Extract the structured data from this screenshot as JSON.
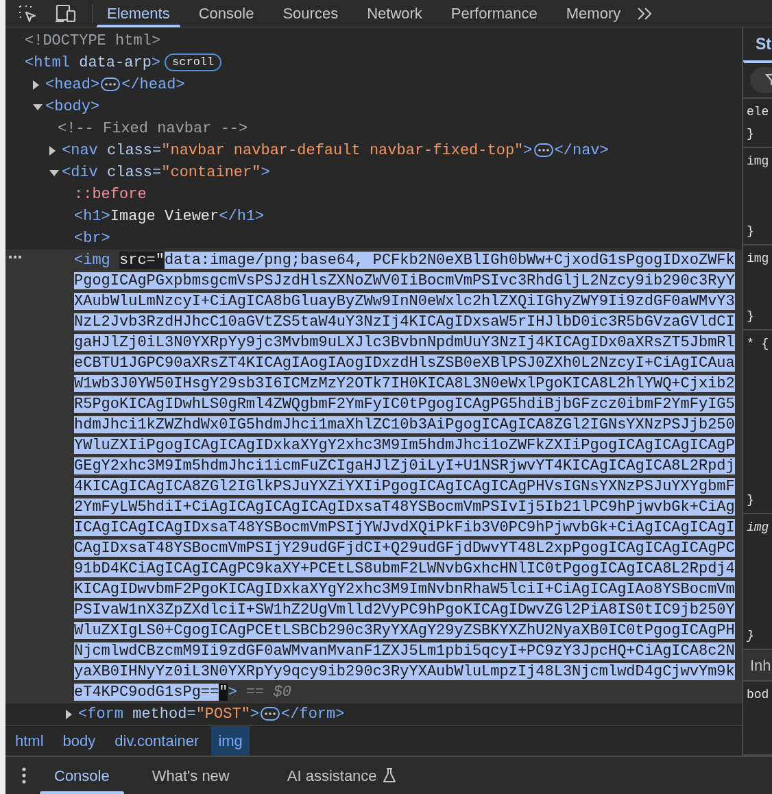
{
  "toolbar": {
    "tabs": [
      {
        "label": "Elements",
        "selected": true
      },
      {
        "label": "Console",
        "selected": false
      },
      {
        "label": "Sources",
        "selected": false
      },
      {
        "label": "Network",
        "selected": false
      },
      {
        "label": "Performance",
        "selected": false
      },
      {
        "label": "Memory",
        "selected": false
      }
    ]
  },
  "dom": [
    {
      "selected": false,
      "tokens": [
        {
          "kind": "doctype",
          "text": "<!DOCTYPE html>"
        }
      ]
    },
    {
      "selected": false,
      "tokens": [
        {
          "kind": "tag",
          "text": "<html"
        },
        {
          "kind": "attr",
          "text": " data-arp"
        },
        {
          "kind": "tag",
          "text": ">"
        },
        {
          "kind": "badge",
          "text": "scroll"
        }
      ],
      "children": [
        {
          "selected": false,
          "expanded": false,
          "tokens": [
            {
              "kind": "tag",
              "text": "<head>"
            },
            {
              "kind": "ellipsis"
            },
            {
              "kind": "tag",
              "text": "</head>"
            }
          ]
        },
        {
          "selected": false,
          "expanded": true,
          "tokens": [
            {
              "kind": "tag",
              "text": "<body>"
            }
          ],
          "children": [
            {
              "selected": false,
              "tokens": [
                {
                  "kind": "comment",
                  "text": "<!-- Fixed navbar -->"
                }
              ]
            },
            {
              "selected": false,
              "expanded": false,
              "tokens": [
                {
                  "kind": "tag",
                  "text": "<nav"
                },
                {
                  "kind": "attr",
                  "text": " class="
                },
                {
                  "kind": "value",
                  "text": "\"navbar navbar-default navbar-fixed-top\""
                },
                {
                  "kind": "tag",
                  "text": ">"
                },
                {
                  "kind": "ellipsis"
                },
                {
                  "kind": "tag",
                  "text": "</nav>"
                }
              ]
            },
            {
              "selected": false,
              "expanded": true,
              "tokens": [
                {
                  "kind": "tag",
                  "text": "<div"
                },
                {
                  "kind": "attr",
                  "text": " class="
                },
                {
                  "kind": "value",
                  "text": "\"container\""
                },
                {
                  "kind": "tag",
                  "text": ">"
                }
              ],
              "children": [
                {
                  "selected": false,
                  "tokens": [
                    {
                      "kind": "pseudo",
                      "text": "::before"
                    }
                  ]
                },
                {
                  "selected": false,
                  "tokens": [
                    {
                      "kind": "tag",
                      "text": "<h1>"
                    },
                    {
                      "kind": "text",
                      "text": "Image Viewer"
                    },
                    {
                      "kind": "tag",
                      "text": "</h1>"
                    }
                  ]
                },
                {
                  "selected": false,
                  "tokens": [
                    {
                      "kind": "tag",
                      "text": "<br>"
                    }
                  ]
                },
                {
                  "selected": true,
                  "tokens": [
                    {
                      "kind": "tag",
                      "text": "<img "
                    },
                    {
                      "kind": "boxed",
                      "text": "src=\""
                    },
                    {
                      "kind": "selection",
                      "lines": [
                        "data:image/png;base64, PCFkb2N0eXBlIGh0bWw+CjxodG1sPgogIDxoZWFk",
                        "PgogICAgPGxpbmsgcmVsPSJzdHlsZXNoZWV0IiBocmVmPSIvc3RhdGljL2Nzcy9ib290c3RyY",
                        "XAubWluLmNzcyI+CiAgICA8bGluayByZWw9InN0eWxlc2hlZXQiIGhyZWY9Ii9zdGF0aWMvY3",
                        "NzL2Jvb3RzdHJhcC10aGVtZS5taW4uY3NzIj4KICAgIDxsaW5rIHJlbD0ic3R5bGVzaGVldCI",
                        "gaHJlZj0iL3N0YXRpYy9jc3Mvbm9uLXJlc3BvbnNpdmUuY3NzIj4KICAgIDx0aXRsZT5JbmRl",
                        "eCBTU1JGPC90aXRsZT4KICAgIAogIAogIDxzdHlsZSB0eXBlPSJ0ZXh0L2NzcyI+CiAgICAua",
                        "W1wb3J0YW50IHsgY29sb3I6ICMzMzY2OTk7IH0KICA8L3N0eWxlPgoKICA8L2hlYWQ+Cjxib2",
                        "R5PgoKICAgIDwhLS0gRml4ZWQgbmF2YmFyIC0tPgogICAgPG5hdiBjbGFzcz0ibmF2YmFyIG5",
                        "hdmJhci1kZWZhdWx0IG5hdmJhci1maXhlZC10b3AiPgogICAgICA8ZGl2IGNsYXNzPSJjb250",
                        "YWluZXIiPgogICAgICAgIDxkaXYgY2xhc3M9Im5hdmJhci1oZWFkZXIiPgogICAgICAgICAgP",
                        "GEgY2xhc3M9Im5hdmJhci1icmFuZCIgaHJlZj0iLyI+U1NSRjwvYT4KICAgICAgICA8L2Rpdj",
                        "4KICAgICAgICA8ZGl2IGlkPSJuYXZiYXIiPgogICAgICAgICAgPHVsIGNsYXNzPSJuYXYgbmF",
                        "2YmFyLW5hdiI+CiAgICAgICAgICAgIDxsaT48YSBocmVmPSIvIj5Ib21lPC9hPjwvbGk+CiAg",
                        "ICAgICAgICAgIDxsaT48YSBocmVmPSIjYWJvdXQiPkFib3V0PC9hPjwvbGk+CiAgICAgICAgI",
                        "CAgIDxsaT48YSBocmVmPSIjY29udGFjdCI+Q29udGFjdDwvYT48L2xpPgogICAgICAgICAgPC",
                        "91bD4KCiAgICAgICAgPC9kaXY+PCEtLS8ubmF2LWNvbGxhcHNlIC0tPgogICAgICA8L2Rpdj4",
                        "KICAgIDwvbmF2PgoKICAgIDxkaXYgY2xhc3M9ImNvbnRhaW5lciI+CiAgICAgIAo8YSBocmVm",
                        "PSIvaW1nX3ZpZXdlciI+SW1hZ2UgVmlld2VyPC9hPgoKICAgIDwvZGl2PiA8IS0tIC9jb250Y",
                        "WluZXIgLS0+CgogICAgPCEtLSBCb290c3RyYXAgY29yZSBKYXZhU2NyaXB0IC0tPgogICAgPH",
                        "NjcmlwdCBzcmM9Ii9zdGF0aWMvanMvanF1ZXJ5Lm1pbi5qcyI+PC9zY3JpcHQ+CiAgICA8c2N",
                        "yaXB0IHNyYz0iL3N0YXRpYy9qcy9ib290c3RyYXAubWluLmpzIj48L3NjcmlwdD4gCjwvYm9k",
                        "eT4KPC9odG1sPg=="
                      ]
                    },
                    {
                      "kind": "cursor",
                      "text": "\""
                    },
                    {
                      "kind": "tag",
                      "text": ">"
                    },
                    {
                      "kind": "hint",
                      "text": " == $0"
                    }
                  ]
                },
                {
                  "selected": false,
                  "expanded": false,
                  "tokens": [
                    {
                      "kind": "tag",
                      "text": "<form"
                    },
                    {
                      "kind": "attr",
                      "text": " method="
                    },
                    {
                      "kind": "value",
                      "text": "\"POST\""
                    },
                    {
                      "kind": "tag",
                      "text": ">"
                    },
                    {
                      "kind": "ellipsis"
                    },
                    {
                      "kind": "tag",
                      "text": "</form>"
                    }
                  ]
                }
              ]
            }
          ]
        }
      ]
    }
  ],
  "breadcrumbs": [
    {
      "label": "html",
      "selected": false
    },
    {
      "label": "body",
      "selected": false
    },
    {
      "label": "div.container",
      "selected": false
    },
    {
      "label": "img",
      "selected": true
    }
  ],
  "styles_pane": {
    "tab": "St",
    "sections": [
      {
        "kind": "filter"
      },
      {
        "kind": "rule",
        "italic": false,
        "lines": [
          "ele",
          "}"
        ]
      },
      {
        "kind": "rule",
        "italic": false,
        "lines": [
          "img",
          "}"
        ]
      },
      {
        "kind": "rule",
        "italic": false,
        "lines": [
          "img",
          "}"
        ]
      },
      {
        "kind": "rule",
        "italic": false,
        "lines": [
          "* {",
          "}"
        ]
      },
      {
        "kind": "rule",
        "italic": true,
        "lines": [
          "img",
          "}"
        ]
      },
      {
        "kind": "header",
        "text": "Inh"
      },
      {
        "kind": "rule",
        "italic": false,
        "lines": [
          "bod"
        ]
      }
    ]
  },
  "drawer": {
    "tabs": [
      {
        "label": "Console",
        "selected": true
      },
      {
        "label": "What's new",
        "selected": false
      },
      {
        "label": "AI assistance",
        "selected": false
      }
    ]
  }
}
